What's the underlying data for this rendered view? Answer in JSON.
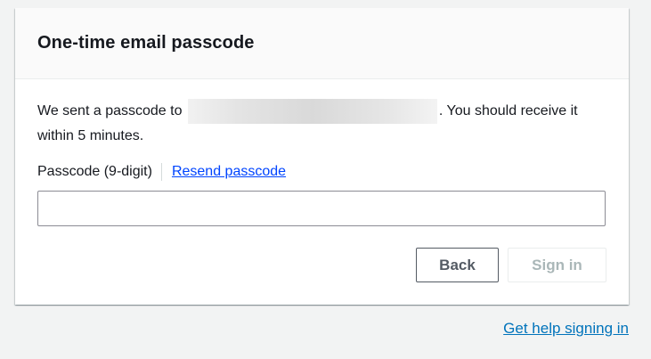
{
  "card": {
    "title": "One-time email passcode",
    "message_prefix": "We sent a passcode to",
    "message_suffix": ". You should receive it within 5 minutes."
  },
  "form": {
    "passcode_label": "Passcode (9-digit)",
    "resend_label": "Resend passcode",
    "passcode_value": "",
    "passcode_placeholder": ""
  },
  "actions": {
    "back_label": "Back",
    "signin_label": "Sign in",
    "signin_disabled": true
  },
  "footer": {
    "help_label": "Get help signing in"
  },
  "colors": {
    "link": "#0044ff",
    "help_link": "#0073bb",
    "page_bg": "#f2f3f3",
    "disabled_text": "#aab7b8"
  }
}
